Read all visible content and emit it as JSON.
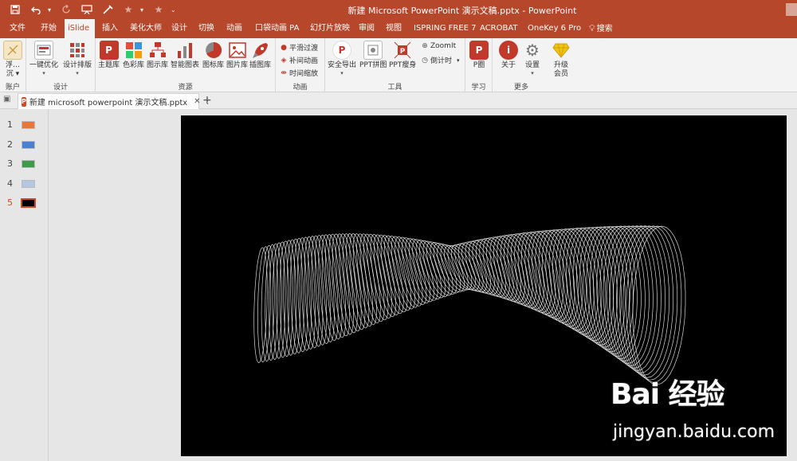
{
  "title_bar": {
    "document_title": "新建 Microsoft PowerPoint 演示文稿.pptx  -  PowerPoint",
    "qat_icons": [
      "save-icon",
      "undo-icon",
      "redo-icon",
      "present-icon",
      "brush-icon",
      "star-icon",
      "star-icon",
      "more-icon"
    ]
  },
  "ribbon_tabs": [
    {
      "label": "文件",
      "active": false
    },
    {
      "label": "开始",
      "active": false
    },
    {
      "label": "iSlide",
      "active": true
    },
    {
      "label": "插入",
      "active": false
    },
    {
      "label": "美化大师",
      "active": false
    },
    {
      "label": "设计",
      "active": false
    },
    {
      "label": "切换",
      "active": false
    },
    {
      "label": "动画",
      "active": false
    },
    {
      "label": "口袋动画 PA",
      "active": false
    },
    {
      "label": "幻灯片放映",
      "active": false
    },
    {
      "label": "审阅",
      "active": false
    },
    {
      "label": "视图",
      "active": false
    },
    {
      "label": "ISPRING FREE 7",
      "active": false
    },
    {
      "label": "ACROBAT",
      "active": false
    },
    {
      "label": "OneKey 6 Pro",
      "active": false
    },
    {
      "label": "搜索",
      "active": false
    }
  ],
  "ribbon": {
    "account": {
      "btn1": "浮…",
      "btn1b": "沉 ▾",
      "label": "账户"
    },
    "design": {
      "btn_optimize": "一键优化",
      "btn_layout": "设计排版",
      "label": "设计"
    },
    "resources": {
      "theme": "主题库",
      "color": "色彩库",
      "diagram": "图示库",
      "chart": "智能图表",
      "icon": "图标库",
      "image": "图片库",
      "illus": "插图库",
      "label": "资源"
    },
    "animation": {
      "smooth": "平滑过渡",
      "tween": "补间动画",
      "time": "时间缩放",
      "label": "动画"
    },
    "tools": {
      "export": "安全导出",
      "puzzle": "PPT拼图",
      "slim": "PPT瘦身",
      "zoomit": "ZoomIt",
      "countdown": "倒计时",
      "label": "工具"
    },
    "learn": {
      "p": "P圈",
      "label": "学习"
    },
    "more": {
      "about": "关于",
      "settings": "设置",
      "upgrade1": "升级",
      "upgrade2": "会员",
      "label": "更多"
    }
  },
  "doc_tab": {
    "name": "新建 microsoft powerpoint 演示文稿.pptx",
    "close": "✕",
    "more": "⋮",
    "new": "+"
  },
  "thumbnails": [
    {
      "num": "1",
      "color": "#e8773d",
      "active": false
    },
    {
      "num": "2",
      "color": "#4a7fd4",
      "active": false
    },
    {
      "num": "3",
      "color": "#3f9a4a",
      "active": false
    },
    {
      "num": "4",
      "color": "#b5c7e0",
      "active": false
    },
    {
      "num": "5",
      "color": "#000000",
      "active": true
    }
  ],
  "watermark": {
    "line1": "Bai 经验",
    "line2": "jingyan.baidu.com"
  },
  "colors": {
    "accent": "#b7472a",
    "ribbon_bg": "#f3f3f3",
    "slide_bg": "#000000"
  }
}
